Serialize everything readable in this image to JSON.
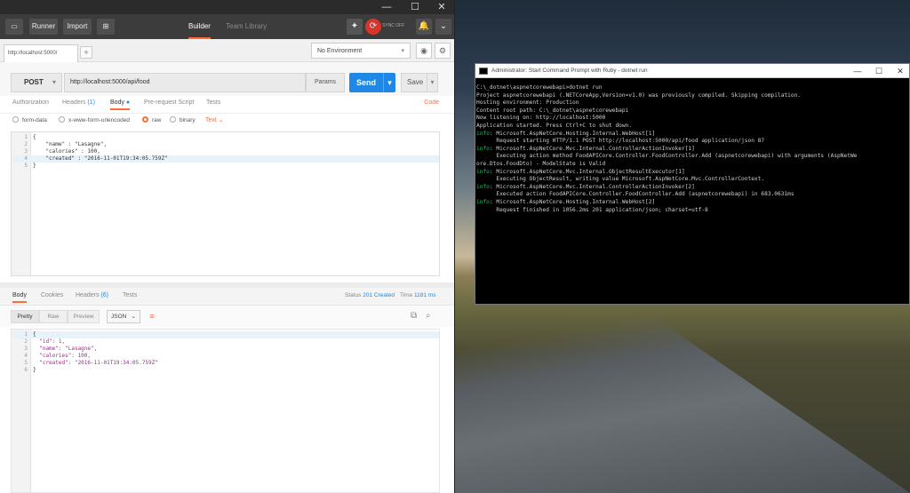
{
  "postman": {
    "window_buttons": [
      "—",
      "☐",
      "✕"
    ],
    "toolbar": {
      "runner": "Runner",
      "import": "Import",
      "tab_builder": "Builder",
      "tab_team_library": "Team Library",
      "sync_label": "SYNC OFF"
    },
    "request_tab_label": "http://localhost:5000/",
    "environment": "No Environment",
    "method": "POST",
    "url": "http://localhost:5000/api/food",
    "params_label": "Params",
    "send_label": "Send",
    "save_label": "Save",
    "request_tabs": [
      {
        "label": "Authorization"
      },
      {
        "label": "Headers",
        "count": "(1)"
      },
      {
        "label": "Body"
      },
      {
        "label": "Pre-request Script"
      },
      {
        "label": "Tests"
      }
    ],
    "code_link": "Code",
    "body_options": [
      "form-data",
      "x-www-form-urlencoded",
      "raw",
      "binary"
    ],
    "text_type": "Text",
    "request_body_lines": [
      {
        "n": "1",
        "text": "{"
      },
      {
        "n": "2",
        "text": "    \"name\" : \"Lasagne\","
      },
      {
        "n": "3",
        "text": "    \"calories\" : 100,"
      },
      {
        "n": "4",
        "text": "    \"created\" : \"2016-11-01T19:34:05.759Z\""
      },
      {
        "n": "5",
        "text": "}"
      }
    ],
    "response_tabs": [
      {
        "label": "Body"
      },
      {
        "label": "Cookies"
      },
      {
        "label": "Headers",
        "count": "(6)"
      },
      {
        "label": "Tests"
      }
    ],
    "status_label": "Status",
    "status_value": "201 Created",
    "time_label": "Time",
    "time_value": "1181 ms",
    "view_modes": [
      "Pretty",
      "Raw",
      "Preview"
    ],
    "format": "JSON",
    "response_body_lines": [
      {
        "n": "1",
        "text": "{"
      },
      {
        "n": "2",
        "text": "  \"id\": 1,"
      },
      {
        "n": "3",
        "text": "  \"name\": \"Lasagne\","
      },
      {
        "n": "4",
        "text": "  \"calories\": 100,"
      },
      {
        "n": "5",
        "text": "  \"created\": \"2016-11-01T19:34:05.759Z\""
      },
      {
        "n": "6",
        "text": "}"
      }
    ]
  },
  "cmd": {
    "title": "Administrator: Start Command Prompt with Ruby - dotnet  run",
    "buttons": [
      "—",
      "☐",
      "✕"
    ],
    "lines": [
      {
        "prefix": "",
        "text": "C:\\_dotnet\\aspnetcorewebapi>dotnet run"
      },
      {
        "prefix": "",
        "text": "Project aspnetcorewebapi (.NETCoreApp,Version=v1.0) was previously compiled. Skipping compilation."
      },
      {
        "prefix": "",
        "text": "Hosting environment: Production"
      },
      {
        "prefix": "",
        "text": "Content root path: C:\\_dotnet\\aspnetcorewebapi"
      },
      {
        "prefix": "",
        "text": "Now listening on: http://localhost:5000"
      },
      {
        "prefix": "",
        "text": "Application started. Press Ctrl+C to shut down."
      },
      {
        "prefix": "info",
        "text": ": Microsoft.AspNetCore.Hosting.Internal.WebHost[1]"
      },
      {
        "prefix": "",
        "text": "      Request starting HTTP/1.1 POST http://localhost:5000/api/food application/json 87"
      },
      {
        "prefix": "info",
        "text": ": Microsoft.AspNetCore.Mvc.Internal.ControllerActionInvoker[1]"
      },
      {
        "prefix": "",
        "text": "      Executing action method FoodAPICore.Controller.FoodController.Add (aspnetcorewebapi) with arguments (AspNetWe"
      },
      {
        "prefix": "",
        "text": "ore.Dtos.FoodDto) - ModelState is Valid"
      },
      {
        "prefix": "info",
        "text": ": Microsoft.AspNetCore.Mvc.Internal.ObjectResultExecutor[1]"
      },
      {
        "prefix": "",
        "text": "      Executing ObjectResult, writing value Microsoft.AspNetCore.Mvc.ControllerContext."
      },
      {
        "prefix": "info",
        "text": ": Microsoft.AspNetCore.Mvc.Internal.ControllerActionInvoker[2]"
      },
      {
        "prefix": "",
        "text": "      Executed action FoodAPICore.Controller.FoodController.Add (aspnetcorewebapi) in 683.0631ms"
      },
      {
        "prefix": "info",
        "text": ": Microsoft.AspNetCore.Hosting.Internal.WebHost[2]"
      },
      {
        "prefix": "",
        "text": "      Request finished in 1056.2ms 201 application/json; charset=utf-8"
      }
    ]
  }
}
